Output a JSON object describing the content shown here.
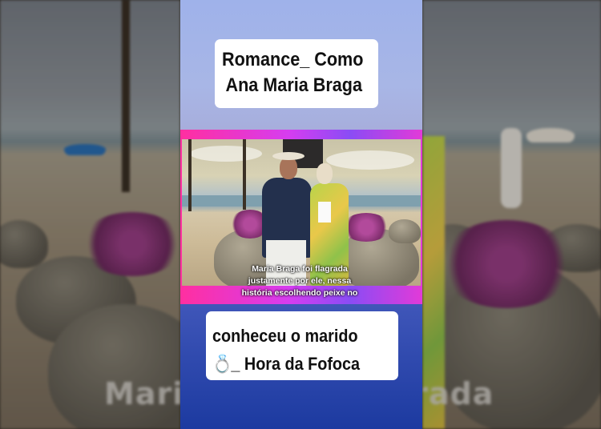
{
  "video": {
    "title_line1": "Romance_ Como",
    "title_line2": "Ana Maria Braga",
    "caption_line1": "conheceu o marido",
    "caption_line2": "_ Hora da Fofoca",
    "caption_icon": "ring-icon",
    "caption_icon_glyph": "💍",
    "subtitle_line1": "Maria Braga foi flagrada",
    "subtitle_line2": "justamente por ele, nessa",
    "subtitle_line3": "história escolhendo peixe no"
  },
  "background": {
    "blurred_caption": "Maria Braga foi flagrada"
  },
  "colors": {
    "band_pink": "#ff2fa0",
    "band_purple": "#8a4cf5",
    "bottom_blue": "#1c3aa0"
  }
}
